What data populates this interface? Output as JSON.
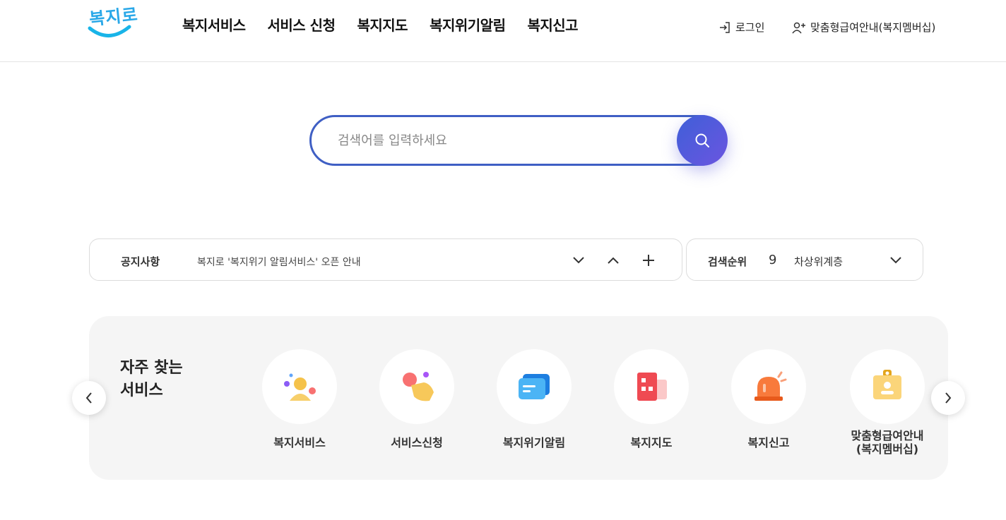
{
  "header": {
    "logo_text": "복지로",
    "nav": [
      "복지서비스",
      "서비스 신청",
      "복지지도",
      "복지위기알림",
      "복지신고"
    ],
    "login_label": "로그인",
    "member_label": "맞춤형급여안내(복지멤버십)"
  },
  "search": {
    "placeholder": "검색어를 입력하세요",
    "button_icon": "search-icon"
  },
  "notice": {
    "label": "공지사항",
    "text": "복지로 '복지위기 알림서비스' 오픈 안내"
  },
  "rank": {
    "label": "검색순위",
    "number": "9",
    "term": "차상위계층"
  },
  "frequent": {
    "title_line1": "자주 찾는",
    "title_line2": "서비스",
    "items": [
      {
        "label": "복지서비스",
        "icon": "person-icon"
      },
      {
        "label": "서비스신청",
        "icon": "hand-tap-icon"
      },
      {
        "label": "복지위기알림",
        "icon": "message-icon"
      },
      {
        "label": "복지지도",
        "icon": "building-map-icon"
      },
      {
        "label": "복지신고",
        "icon": "siren-icon"
      },
      {
        "label_line1": "맞춤형급여안내",
        "label_line2": "(복지멤버십)",
        "icon": "id-card-icon"
      }
    ]
  },
  "colors": {
    "accent": "#3f5fc4",
    "logo": "#2aa8e8",
    "panel": "#f5f5f5"
  }
}
